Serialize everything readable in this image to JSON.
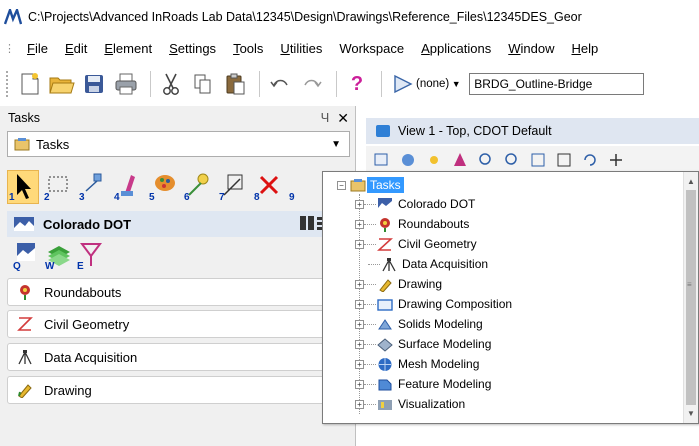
{
  "window": {
    "title": "C:\\Projects\\Advanced InRoads Lab Data\\12345\\Design\\Drawings\\Reference_Files\\12345DES_Geor"
  },
  "menu": {
    "items": [
      {
        "underline": "F",
        "rest": "ile"
      },
      {
        "underline": "E",
        "rest": "dit"
      },
      {
        "underline": "E",
        "rest": "lement"
      },
      {
        "underline": "S",
        "rest": "ettings"
      },
      {
        "underline": "T",
        "rest": "ools"
      },
      {
        "underline": "U",
        "rest": "tilities"
      },
      {
        "underline": "",
        "rest": "Workspace"
      },
      {
        "underline": "A",
        "rest": "pplications"
      },
      {
        "underline": "W",
        "rest": "indow"
      },
      {
        "underline": "H",
        "rest": "elp"
      }
    ]
  },
  "toolbar": {
    "active_level_text": "(none)",
    "level_combo_value": "BRDG_Outline-Bridge",
    "help_glyph": "?"
  },
  "tasks_panel": {
    "header_label": "Tasks",
    "pin_glyph": "Ч",
    "close_glyph": "✕",
    "combo_value": "Tasks",
    "tool_numbers": [
      "1",
      "2",
      "3",
      "4",
      "5",
      "6",
      "7",
      "8",
      "9"
    ],
    "active_section": "Colorado DOT",
    "sub_tool_numbers": [
      "Q",
      "W",
      "E"
    ],
    "sections": [
      "Roundabouts",
      "Civil Geometry",
      "Data Acquisition",
      "Drawing"
    ]
  },
  "view": {
    "title": "View 1 - Top, CDOT Default"
  },
  "tree": {
    "root": "Tasks",
    "items": [
      {
        "label": "Colorado DOT",
        "expandable": true
      },
      {
        "label": "Roundabouts",
        "expandable": true
      },
      {
        "label": "Civil Geometry",
        "expandable": true
      },
      {
        "label": "Data Acquisition",
        "expandable": false
      },
      {
        "label": "Drawing",
        "expandable": true
      },
      {
        "label": "Drawing Composition",
        "expandable": true
      },
      {
        "label": "Solids Modeling",
        "expandable": true
      },
      {
        "label": "Surface Modeling",
        "expandable": true
      },
      {
        "label": "Mesh Modeling",
        "expandable": true
      },
      {
        "label": "Feature Modeling",
        "expandable": true
      },
      {
        "label": "Visualization",
        "expandable": true
      }
    ]
  },
  "colors": {
    "selection": "#3399ff",
    "active_tool": "#ffd97a",
    "panel_bg": "#f0f0f0",
    "view_title_bg": "#dfe6f1"
  }
}
